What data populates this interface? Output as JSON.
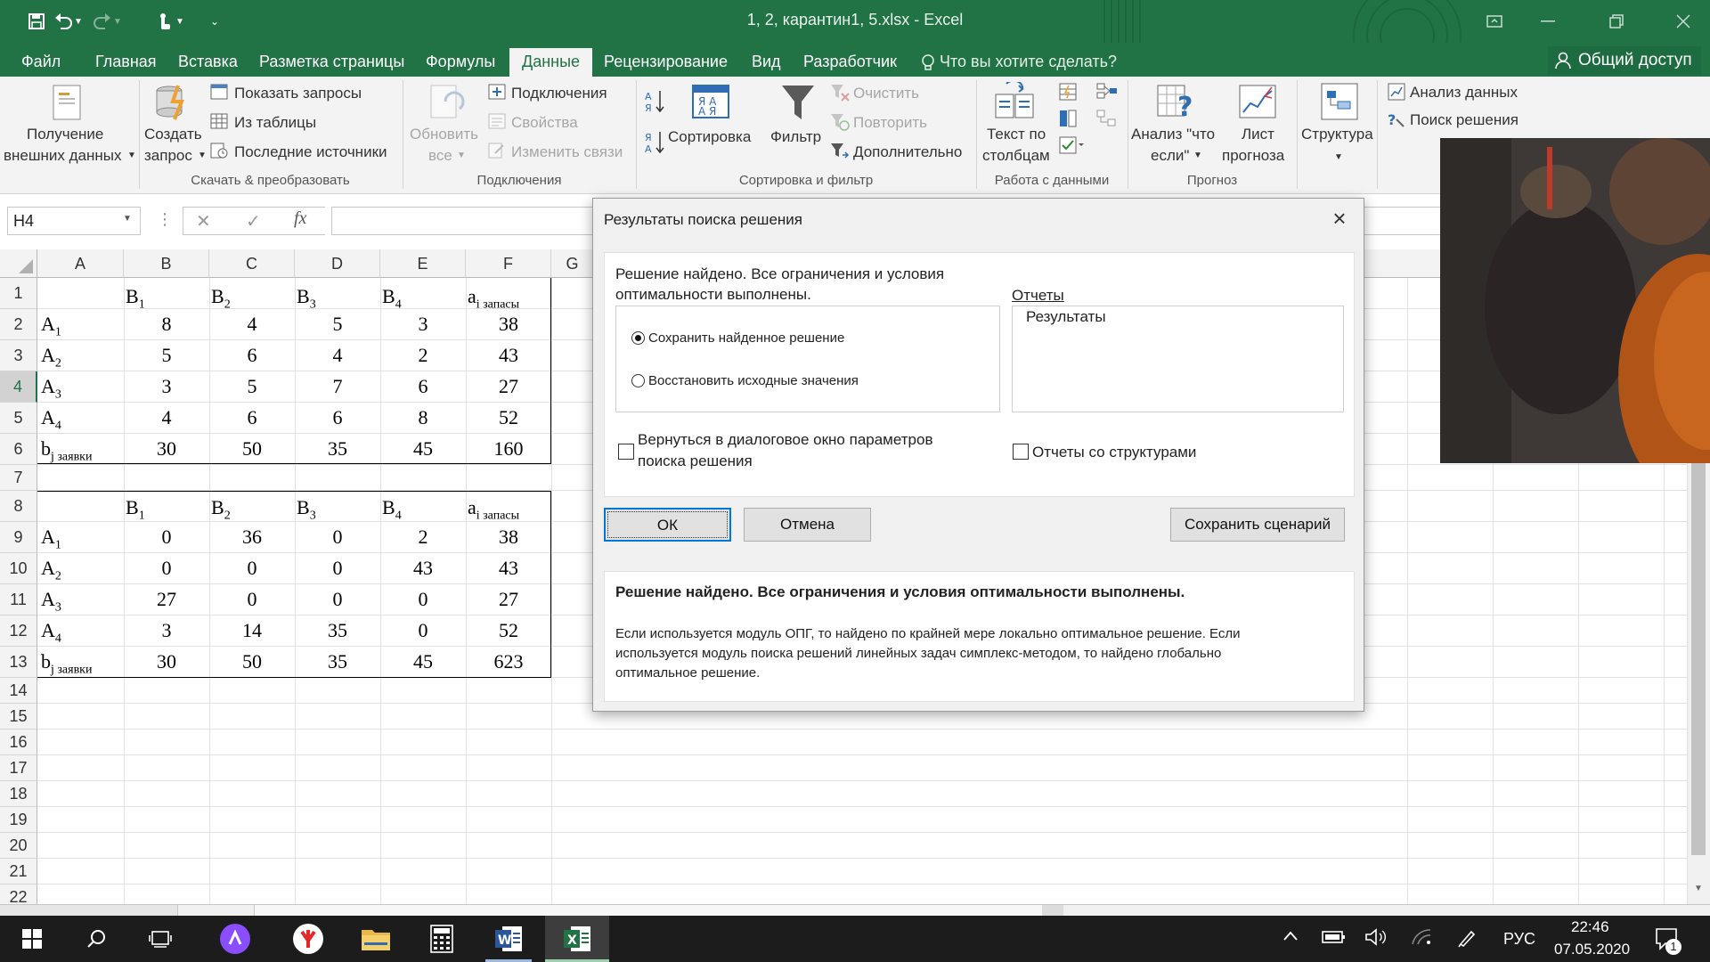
{
  "titlebar": {
    "title": "1, 2, карантин1, 5.xlsx  -  Excel",
    "qat_icons": [
      "save-icon",
      "undo-icon",
      "redo-icon",
      "touch-mode-icon",
      "customize-icon"
    ]
  },
  "tabs": [
    {
      "label": "Файл"
    },
    {
      "label": "Главная"
    },
    {
      "label": "Вставка"
    },
    {
      "label": "Разметка страницы"
    },
    {
      "label": "Формулы"
    },
    {
      "label": "Данные",
      "active": true
    },
    {
      "label": "Рецензирование"
    },
    {
      "label": "Вид"
    },
    {
      "label": "Разработчик"
    }
  ],
  "tellme": "Что вы хотите сделать?",
  "share": "Общий доступ",
  "ribbon": {
    "get_external": [
      "Получение",
      "внешних данных"
    ],
    "create_query": [
      "Создать",
      "запрос"
    ],
    "show_queries": "Показать запросы",
    "from_table": "Из таблицы",
    "recent_sources": "Последние источники",
    "group_transform": "Скачать & преобразовать",
    "refresh": [
      "Обновить",
      "все"
    ],
    "connections": "Подключения",
    "properties": "Свойства",
    "edit_links": "Изменить связи",
    "group_connections": "Подключения",
    "sort": "Сортировка",
    "filter": "Фильтр",
    "clear": "Очистить",
    "reapply": "Повторить",
    "advanced": "Дополнительно",
    "group_sort": "Сортировка и фильтр",
    "text_to_cols": [
      "Текст по",
      "столбцам"
    ],
    "group_data_tools": "Работа с данными",
    "whatif": [
      "Анализ \"что",
      "если\""
    ],
    "forecast": [
      "Лист",
      "прогноза"
    ],
    "group_forecast": "Прогноз",
    "outline": "Структура",
    "data_analysis": "Анализ данных",
    "solver": "Поиск решения"
  },
  "formula_bar": {
    "name_box": "H4",
    "fx": "fx",
    "formula": ""
  },
  "columns": [
    "A",
    "B",
    "C",
    "D",
    "E",
    "F",
    "G"
  ],
  "rows": [
    "1",
    "2",
    "3",
    "4",
    "5",
    "6",
    "7",
    "8",
    "9",
    "10",
    "11",
    "12",
    "13",
    "14",
    "15",
    "16",
    "17",
    "18",
    "19",
    "20",
    "21",
    "22"
  ],
  "table1": {
    "header": {
      "b1": "B",
      "b2": "B",
      "b3": "B",
      "b4": "B",
      "a": "a",
      "sub1": "1",
      "sub2": "2",
      "sub3": "3",
      "sub4": "4",
      "asub": "i запасы"
    },
    "rows": [
      {
        "label": "A",
        "sub": "1",
        "v": [
          "8",
          "4",
          "5",
          "3",
          "38"
        ]
      },
      {
        "label": "A",
        "sub": "2",
        "v": [
          "5",
          "6",
          "4",
          "2",
          "43"
        ]
      },
      {
        "label": "A",
        "sub": "3",
        "v": [
          "3",
          "5",
          "7",
          "6",
          "27"
        ]
      },
      {
        "label": "A",
        "sub": "4",
        "v": [
          "4",
          "6",
          "6",
          "8",
          "52"
        ]
      },
      {
        "label": "b",
        "sub": "j заявки",
        "v": [
          "30",
          "50",
          "35",
          "45",
          "160"
        ]
      }
    ]
  },
  "table2": {
    "rows": [
      {
        "label": "A",
        "sub": "1",
        "v": [
          "0",
          "36",
          "0",
          "2",
          "38"
        ]
      },
      {
        "label": "A",
        "sub": "2",
        "v": [
          "0",
          "0",
          "0",
          "43",
          "43"
        ]
      },
      {
        "label": "A",
        "sub": "3",
        "v": [
          "27",
          "0",
          "0",
          "0",
          "27"
        ]
      },
      {
        "label": "A",
        "sub": "4",
        "v": [
          "3",
          "14",
          "35",
          "0",
          "52"
        ]
      },
      {
        "label": "b",
        "sub": "j заявки",
        "v": [
          "30",
          "50",
          "35",
          "45",
          "623"
        ]
      }
    ]
  },
  "dialog": {
    "title": "Результаты поиска решения",
    "status_line1": "Решение найдено. Все ограничения и условия",
    "status_line2": "оптимальности выполнены.",
    "keep_solution": "Сохранить найденное решение",
    "restore_values": "Восстановить исходные значения",
    "reports_label": "Отчеты",
    "reports_item": "Результаты",
    "return_line1": "Вернуться в диалоговое окно параметров",
    "return_line2": "поиска решения",
    "outline_reports": "Отчеты со структурами",
    "ok": "ОК",
    "cancel": "Отмена",
    "save_scenario": "Сохранить сценарий",
    "info_title": "Решение найдено. Все ограничения и условия оптимальности выполнены.",
    "info_line1": "Если используется модуль ОПГ, то найдено по крайней мере локально оптимальное решение. Если",
    "info_line2": "используется модуль поиска решений линейных задач симплекс-методом, то найдено глобально",
    "info_line3": "оптимальное решение."
  },
  "taskbar": {
    "lang": "РУС",
    "time": "22:46",
    "date": "07.05.2020",
    "notif_count": "1"
  },
  "colors": {
    "excel_green": "#217346",
    "taskbar": "#1c1c1c",
    "ribbon_bg": "#f3f3f3"
  }
}
